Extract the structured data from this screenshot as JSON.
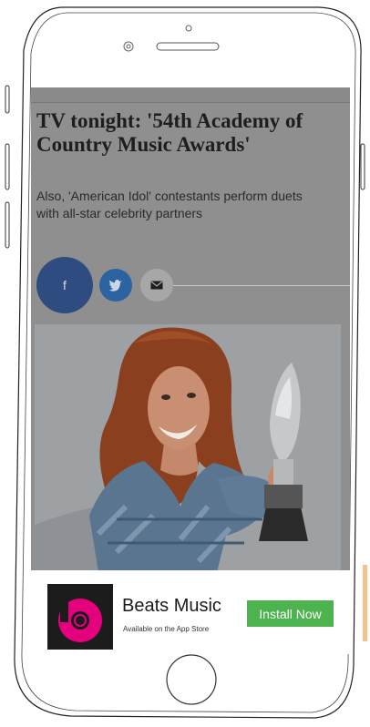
{
  "article": {
    "headline": "TV tonight: '54th Academy of Country Music Awards'",
    "subheadline": "Also, 'American Idol' contestants perform duets with all-star celebrity partners",
    "share": {
      "facebook_glyph": "f"
    }
  },
  "ad": {
    "app_name": "Beats Music",
    "tagline": "Available on the App Store",
    "install_label": "Install Now",
    "brand_color": "#e5007d",
    "button_color": "#4cb34e"
  },
  "icons": [
    "facebook-icon",
    "twitter-icon",
    "email-icon",
    "beats-logo-icon",
    "camera-icon",
    "speaker-icon",
    "home-button"
  ]
}
